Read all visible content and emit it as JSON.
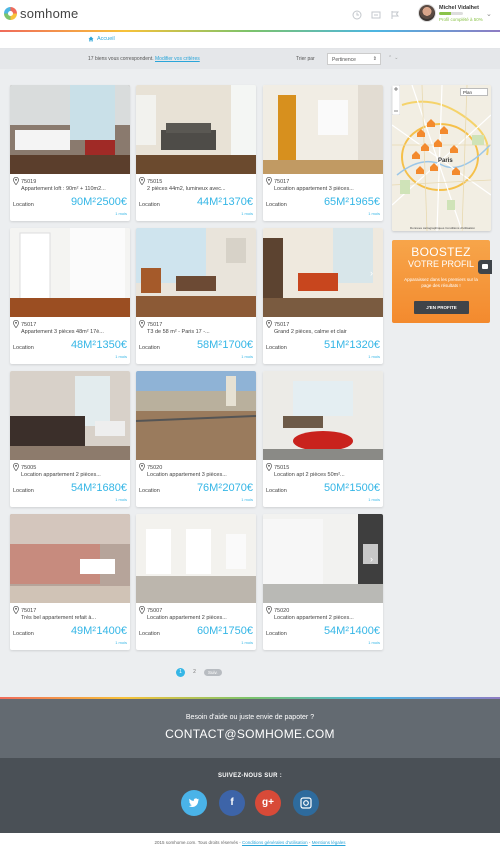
{
  "header": {
    "logo_text": "somhome",
    "user_name": "Michel Vidalhet",
    "profile_progress": "Profil complété à 50%",
    "profile_progress_value": 50
  },
  "breadcrumb": {
    "home": "Accueil"
  },
  "filters": {
    "results_text": "17 biens vous correspondent.",
    "modify_link": "Modifier vos critères",
    "sort_label": "Trier par",
    "sort_value": "Pertinence"
  },
  "listings": [
    {
      "zip": "75019",
      "title": "Appartement loft : 90m² + 110m2...",
      "type": "Location",
      "area": "90M²",
      "price": "2500€",
      "months": "1 mois"
    },
    {
      "zip": "75015",
      "title": "2 pièces 44m2, lumineux avec...",
      "type": "Location",
      "area": "44M²",
      "price": "1370€",
      "months": "1 mois"
    },
    {
      "zip": "75017",
      "title": "Location appartement 3 pièces...",
      "type": "Location",
      "area": "65M²",
      "price": "1965€",
      "months": "1 mois"
    },
    {
      "zip": "75017",
      "title": "Appartement 3 pièces 48m² 17è...",
      "type": "Location",
      "area": "48M²",
      "price": "1350€",
      "months": "1 mois"
    },
    {
      "zip": "75017",
      "title": "T3 de 58 m² - Paris 17 -...",
      "type": "Location",
      "area": "58M²",
      "price": "1700€",
      "months": "1 mois"
    },
    {
      "zip": "75017",
      "title": "Grand 2 pièces, calme et clair",
      "type": "Location",
      "area": "51M²",
      "price": "1320€",
      "months": "1 mois"
    },
    {
      "zip": "75005",
      "title": "Location appartement 2 pièces...",
      "type": "Location",
      "area": "54M²",
      "price": "1680€",
      "months": "1 mois"
    },
    {
      "zip": "75020",
      "title": "Location appartement 3 pièces...",
      "type": "Location",
      "area": "76M²",
      "price": "2070€",
      "months": "1 mois"
    },
    {
      "zip": "75015",
      "title": "Location apt 2 pièces 50m²...",
      "type": "Location",
      "area": "50M²",
      "price": "1500€",
      "months": "1 mois"
    },
    {
      "zip": "75017",
      "title": "Très bel appartement refait à...",
      "type": "Location",
      "area": "49M²",
      "price": "1400€",
      "months": "1 mois"
    },
    {
      "zip": "75007",
      "title": "Location appartement 2 pièces...",
      "type": "Location",
      "area": "60M²",
      "price": "1750€",
      "months": "1 mois"
    },
    {
      "zip": "75020",
      "title": "Location appartement 2 pièces...",
      "type": "Location",
      "area": "54M²",
      "price": "1400€",
      "months": "1 mois"
    }
  ],
  "map": {
    "type_select": "Plan",
    "city_label": "Paris",
    "credit": "Données cartographiques   Conditions d'utilisation"
  },
  "boost": {
    "title": "BOOSTEZ",
    "subtitle": "VOTRE PROFIL",
    "text": "Apparaissez dans les premiers sur la page des résultats !",
    "button": "J'EN PROFITE"
  },
  "pagination": {
    "page1": "1",
    "page2": "2",
    "next": "Suiv."
  },
  "footer": {
    "help": "Besoin d'aide ou juste envie de papoter ?",
    "contact": "CONTACT@SOMHOME.COM",
    "follow": "SUIVEZ-NOUS SUR :",
    "legal_prefix": "2015 somhome.com. Tous droits réservés -",
    "terms_link": "Conditions générales d'utilisation",
    "legal_sep": "-",
    "mentions_link": "Mentions légales"
  },
  "colors": {
    "accent": "#35b6e6",
    "boost": "#f38a2e",
    "footer": "#636a71"
  }
}
